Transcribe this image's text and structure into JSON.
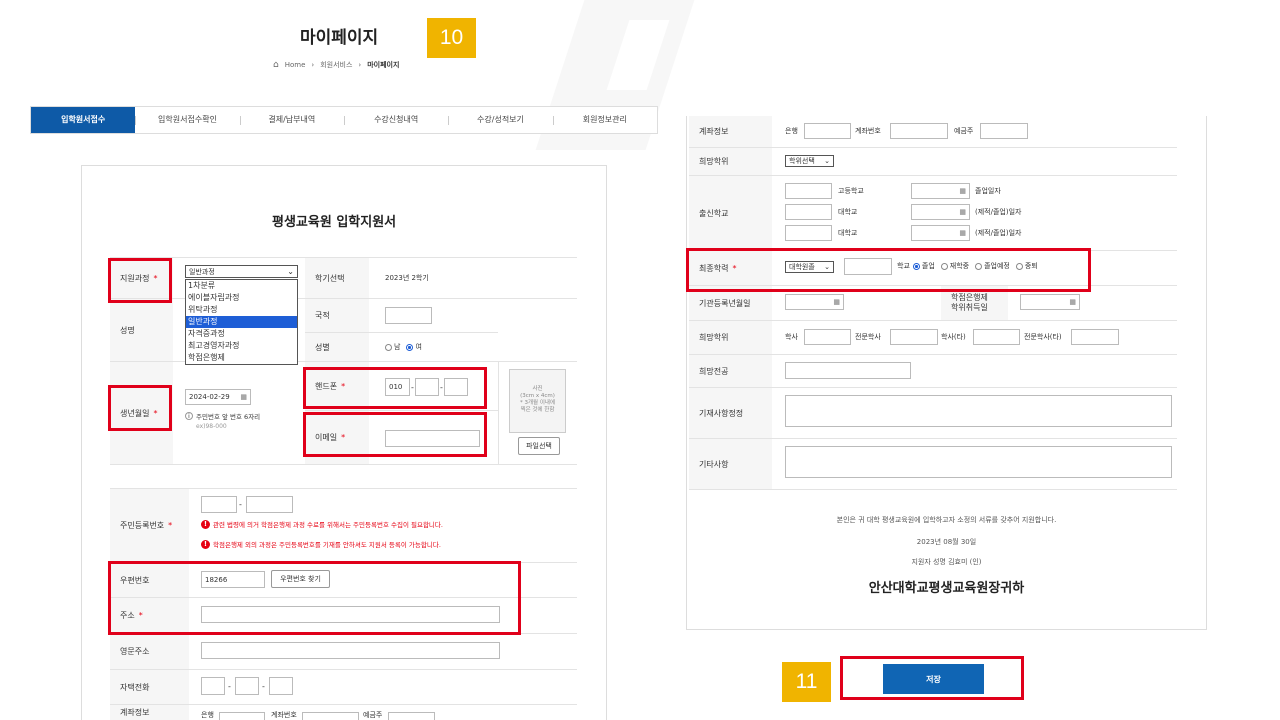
{
  "header": {
    "title": "마이페이지",
    "step_top": "10",
    "step_bottom": "11"
  },
  "breadcrumb": {
    "home": "Home",
    "mid": "회원서비스",
    "current": "마이페이지"
  },
  "tabs": [
    "입학원서접수",
    "입학원서접수확인",
    "결제/납부내역",
    "수강신청내역",
    "수강/성적보기",
    "회원정보관리"
  ],
  "form": {
    "title": "평생교육원 입학지원서",
    "course_label": "지원과정",
    "course_selected": "일반과정",
    "course_options": [
      "1차분류",
      "에이블자립과정",
      "위탁과정",
      "일반과정",
      "자격증과정",
      "최고경영자과정",
      "학점은행제"
    ],
    "term_label": "학기선택",
    "term_value": "2023년 2학기",
    "name_label": "성명",
    "nationality_label": "국적",
    "gender_label": "성별",
    "gender_male": "남",
    "gender_female": "여",
    "birth_label": "생년월일",
    "birth_value": "2024-02-29",
    "birth_hint": "주민번호 앞 번호 6자리",
    "birth_hint_2": "ex)98-000",
    "phone_label": "핸드폰",
    "phone_prefix": "010",
    "email_label": "이메일",
    "photo_text_1": "사진",
    "photo_text_2": "(3cm x 4cm)",
    "photo_text_3": "* 3개월 이내에",
    "photo_text_4": "찍은 것에 한함",
    "file_button": "파일선택",
    "rrn_label": "주민등록번호",
    "rrn_warn_1": "관련 법령에 의거 학점은행제 과정 수료를 위해서는 주민등록번호 수집이 필요합니다.",
    "rrn_warn_2": "학점은행제 외의 과정은 주민등록번호를 기재를 안하셔도 지원서 등록이 가능합니다.",
    "zip_label": "우편번호",
    "zip_value": "18266",
    "zip_button": "우편번호 찾기",
    "address_label": "주소",
    "eng_address_label": "영문주소",
    "home_phone_label": "자택전화",
    "account_label": "계좌정보",
    "bank_label": "은행",
    "account_no_label": "계좌번호",
    "holder_label": "예금주"
  },
  "right": {
    "account_label": "계좌정보",
    "bank_label": "은행",
    "account_no_label": "계좌번호",
    "holder_label": "예금주",
    "degree_label": "희망학위",
    "degree_select": "학위선택",
    "school_label": "출신학교",
    "highschool": "고등학교",
    "grad_date": "졸업일자",
    "university": "대학교",
    "univ_date": "(제적/졸업)일자",
    "final_edu_label": "최종학력",
    "final_edu_select": "대학원졸",
    "school_suffix": "학교",
    "status_options": [
      "졸업",
      "재학중",
      "졸업예정",
      "중퇴"
    ],
    "reg_date_label": "기관등록년월일",
    "credit_date_label_1": "학점은행제",
    "credit_date_label_2": "학위취득일",
    "desired_degree_label": "희망학위",
    "bachelor": "학사",
    "pro_bachelor": "전문학사",
    "bachelor_other": "학사(타)",
    "pro_bachelor_other": "전문학사(타)",
    "major_label": "희망전공",
    "remark_label": "기재사항정정",
    "etc_label": "기타사항",
    "declaration": "본인은 귀 대학 평생교육원에 입학하고자 소정의 서류를 갖추어 지원합니다.",
    "date": "2023년 08월 30일",
    "applicant": "지원자 성명 김효미 (인)",
    "closing": "안산대학교평생교육원장귀하",
    "save_button": "저장"
  },
  "colors": {
    "primary": "#0e5aa7",
    "highlight": "#e0001a",
    "badge": "#f0b400"
  }
}
